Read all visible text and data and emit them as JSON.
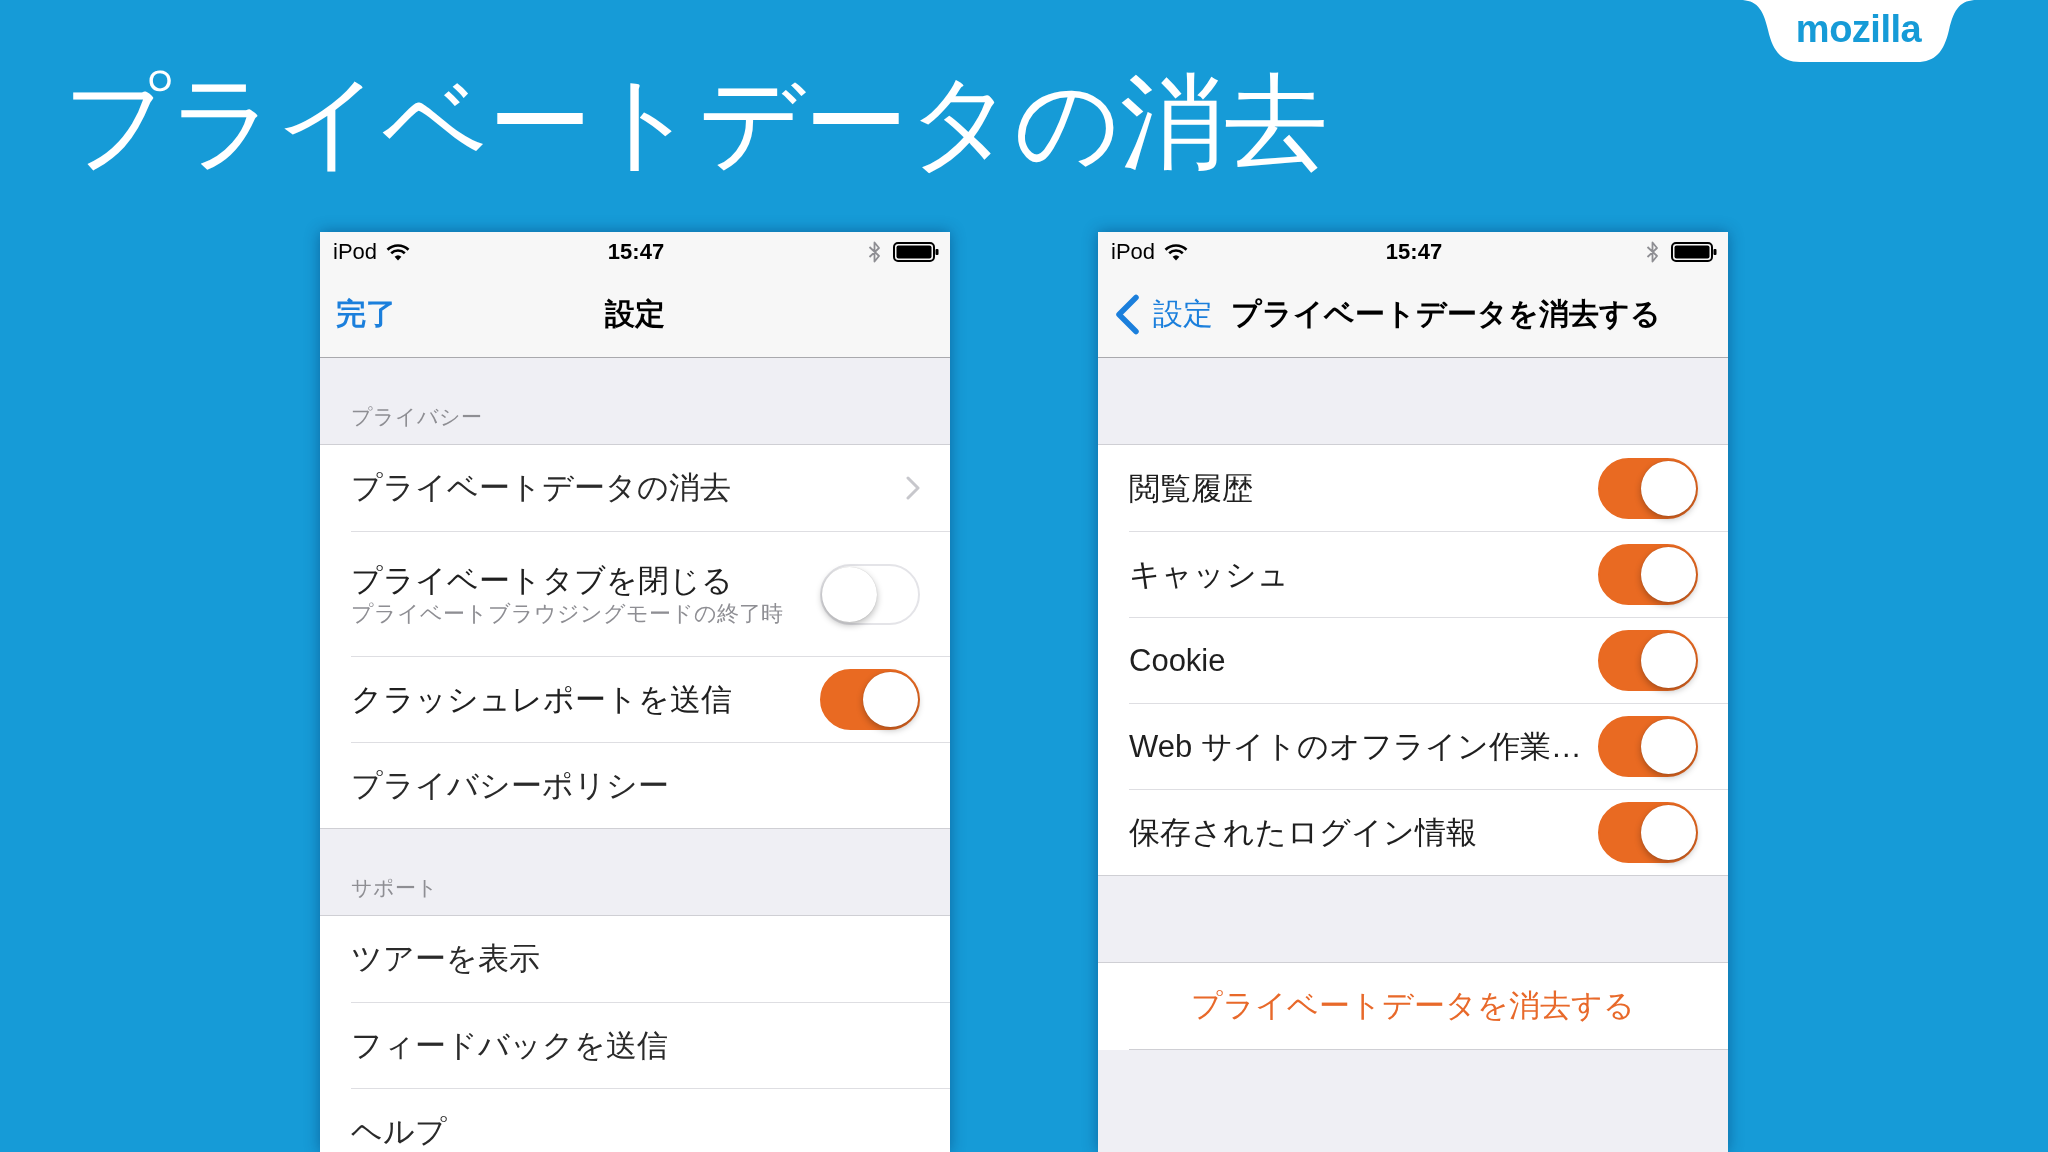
{
  "slide": {
    "title": "プライベートデータの消去",
    "logo": "mozilla"
  },
  "screens": [
    {
      "status_bar": {
        "device": "iPod",
        "time": "15:47"
      },
      "nav_bar": {
        "button": {
          "kind": "done",
          "label": "完了"
        },
        "title": "設定"
      },
      "sections": [
        {
          "header": "プライバシー",
          "items": [
            {
              "kind": "disclosure",
              "label": "プライベートデータの消去"
            },
            {
              "kind": "toggle",
              "label": "プライベートタブを閉じる",
              "detail": "プライベートブラウジングモードの終了時",
              "on": false
            },
            {
              "kind": "toggle",
              "label": "クラッシュレポートを送信",
              "on": true
            },
            {
              "kind": "plain",
              "label": "プライバシーポリシー"
            }
          ]
        },
        {
          "header": "サポート",
          "items": [
            {
              "kind": "plain",
              "label": "ツアーを表示"
            },
            {
              "kind": "plain",
              "label": "フィードバックを送信"
            },
            {
              "kind": "plain",
              "label": "ヘルプ"
            }
          ]
        }
      ]
    },
    {
      "status_bar": {
        "device": "iPod",
        "time": "15:47"
      },
      "nav_bar": {
        "button": {
          "kind": "back",
          "label": "設定"
        },
        "title": "プライベートデータを消去する"
      },
      "sections": [
        {
          "items": [
            {
              "kind": "toggle",
              "label": "閲覧履歴",
              "on": true
            },
            {
              "kind": "toggle",
              "label": "キャッシュ",
              "on": true
            },
            {
              "kind": "toggle",
              "label": "Cookie",
              "on": true
            },
            {
              "kind": "toggle",
              "label": "Web サイトのオフライン作業…",
              "on": true
            },
            {
              "kind": "toggle",
              "label": "保存されたログイン情報",
              "on": true
            }
          ]
        },
        {
          "items": [
            {
              "kind": "action",
              "label": "プライベートデータを消去する"
            }
          ]
        }
      ]
    }
  ]
}
